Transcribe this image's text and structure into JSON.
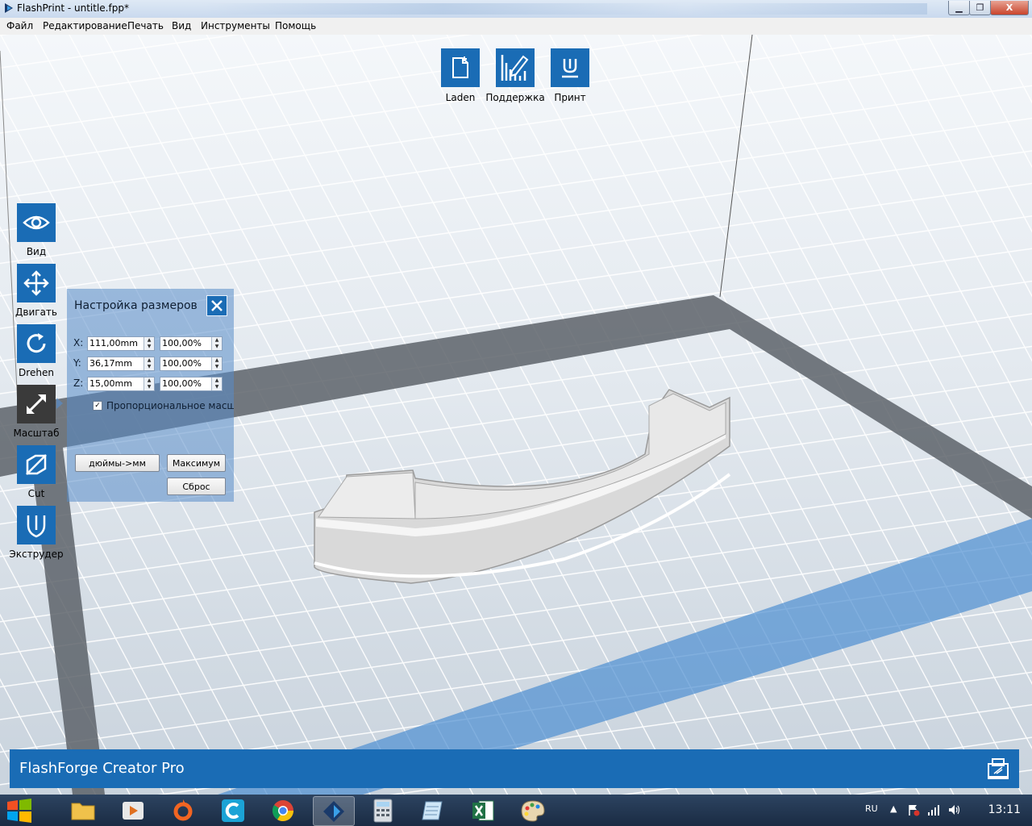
{
  "window": {
    "title": "FlashPrint - untitle.fpp*",
    "minimize": "▁",
    "maximize": "❐",
    "close": "X"
  },
  "menu": [
    "Файл",
    "Редактирование",
    "Печать",
    "Вид",
    "Инструменты",
    "Помощь"
  ],
  "top_tools": [
    {
      "label": "Laden",
      "icon": "load-file-icon"
    },
    {
      "label": "Поддержка",
      "icon": "support-icon"
    },
    {
      "label": "Принт",
      "icon": "print-icon"
    }
  ],
  "left_tools": [
    {
      "label": "Вид",
      "icon": "eye-icon"
    },
    {
      "label": "Двигать",
      "icon": "move-icon"
    },
    {
      "label": "Drehen",
      "icon": "rotate-icon"
    },
    {
      "label": "Масштаб",
      "icon": "scale-icon",
      "active": true
    },
    {
      "label": "Cut",
      "icon": "cut-icon"
    },
    {
      "label": "Экструдер",
      "icon": "extruder-icon"
    }
  ],
  "scale_panel": {
    "title": "Настройка размеров",
    "rows": [
      {
        "axis": "X:",
        "size": "111,00mm",
        "percent": "100,00%"
      },
      {
        "axis": "Y:",
        "size": "36,17mm",
        "percent": "100,00%"
      },
      {
        "axis": "Z:",
        "size": "15,00mm",
        "percent": "100,00%"
      }
    ],
    "proportional_label": "Пропорциональное масш",
    "proportional_checked": "✓",
    "inch_to_mm": "дюймы->мм",
    "maximum": "Максимум",
    "reset": "Сброс"
  },
  "printer_name": "FlashForge Creator Pro",
  "taskbar": {
    "lang": "RU",
    "time": "13:11"
  },
  "colors": {
    "accent": "#1a6cb5",
    "active_tool": "#3a3a3a"
  }
}
